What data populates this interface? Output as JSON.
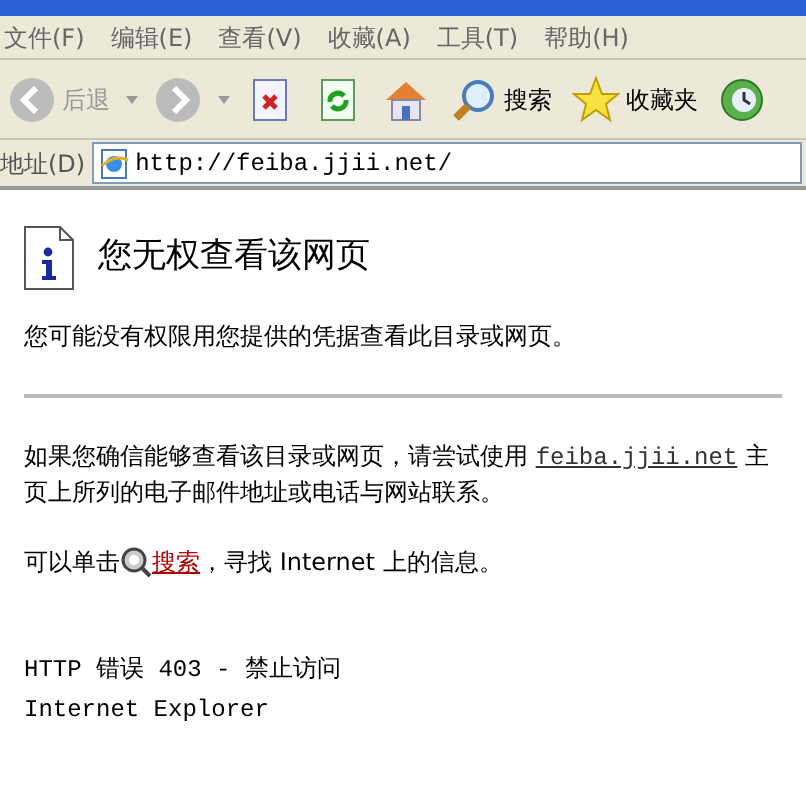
{
  "menu": [
    {
      "label": "文件(F)"
    },
    {
      "label": "编辑(E)"
    },
    {
      "label": "查看(V)"
    },
    {
      "label": "收藏(A)"
    },
    {
      "label": "工具(T)"
    },
    {
      "label": "帮助(H)"
    }
  ],
  "toolbar": [
    {
      "kind": "back",
      "label": "后退",
      "disabled": true
    },
    {
      "kind": "forward",
      "disabled": true
    },
    {
      "kind": "stop"
    },
    {
      "kind": "refresh"
    },
    {
      "kind": "home"
    },
    {
      "kind": "search",
      "label": "搜索"
    },
    {
      "kind": "favorites",
      "label": "收藏夹"
    },
    {
      "kind": "history"
    }
  ],
  "address": {
    "label": "地址(D)",
    "value": "http://feiba.jjii.net/"
  },
  "page": {
    "title": "您无权查看该网页",
    "message": "您可能没有权限用您提供的凭据查看此目录或网页。",
    "contact": {
      "before": "如果您确信能够查看该目录或网页，请尝试使用",
      "link": "feiba.jjii.net",
      "after": "主页上所列的电子邮件地址或电话与网站联系。"
    },
    "search": {
      "before": "可以单击",
      "link": "搜索",
      "after": "，寻找 Internet 上的信息。"
    },
    "error": "HTTP 错误 403 - 禁止访问",
    "browser": "Internet Explorer"
  }
}
